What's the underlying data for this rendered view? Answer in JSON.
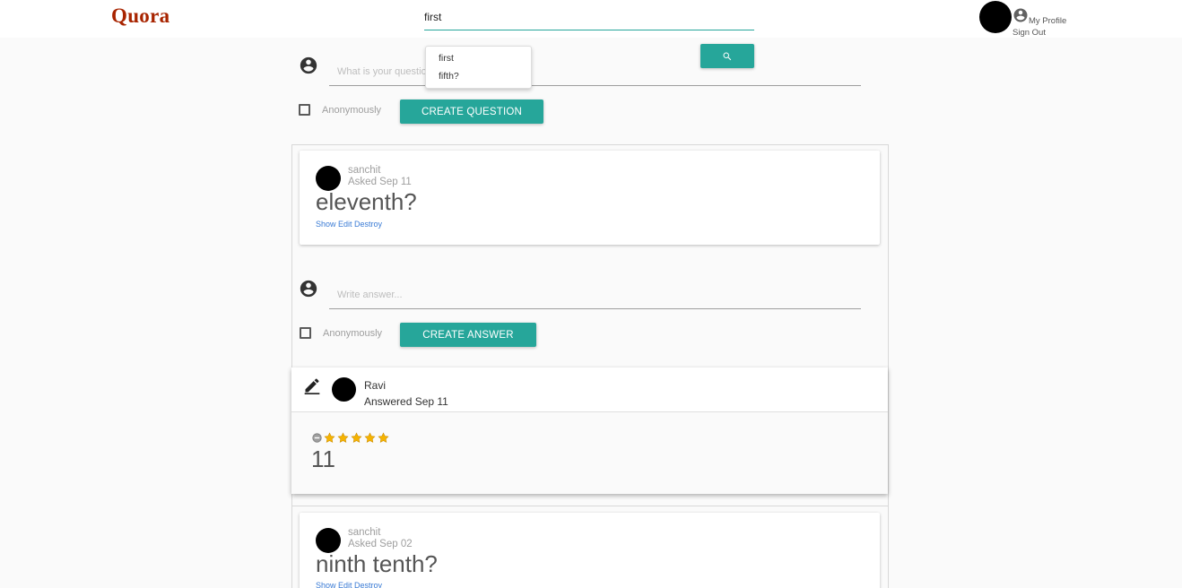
{
  "header": {
    "logo": "Quora",
    "search_value": "first",
    "my_profile": "My Profile",
    "sign_out": "Sign Out"
  },
  "autocomplete": {
    "options": [
      "first",
      "fifth?"
    ]
  },
  "question_form": {
    "placeholder": "What is your question?",
    "anonymous_label": "Anonymously",
    "submit_label": "CREATE QUESTION"
  },
  "questions": [
    {
      "author": "sanchit",
      "date": "Asked Sep 11",
      "title": "eleventh?",
      "actions": "Show Edit Destroy"
    },
    {
      "author": "sanchit",
      "date": "Asked Sep 02",
      "title": "ninth tenth?",
      "actions": "Show Edit Destroy"
    }
  ],
  "answer_form": {
    "placeholder": "Write answer...",
    "anonymous_label": "Anonymously",
    "submit_label": "CREATE ANSWER"
  },
  "answer": {
    "author": "Ravi",
    "date": "Answered Sep 11",
    "rating": 5,
    "rating_max": 5,
    "body": "11"
  },
  "colors": {
    "accent": "#26a69a",
    "logo": "#a82400",
    "link": "#3a7bd5"
  },
  "icons": [
    "account-circle-icon",
    "search-icon",
    "edit-pencil-icon",
    "star-icon",
    "cancel-rating-icon"
  ]
}
